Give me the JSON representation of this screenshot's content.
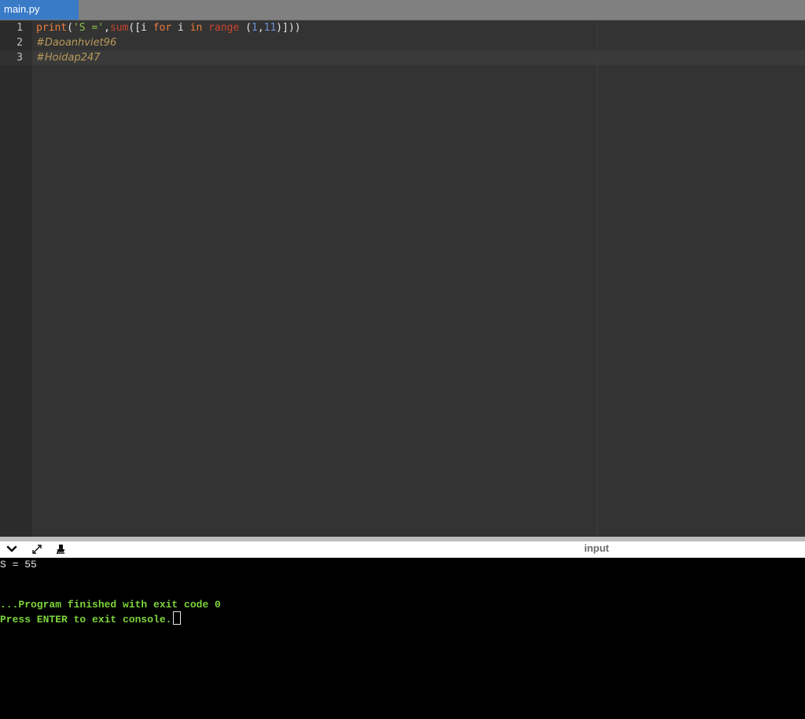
{
  "tab": {
    "label": "main.py"
  },
  "editor": {
    "lines": [
      {
        "number": "1",
        "tokens": {
          "t0": "print",
          "t1": "(",
          "t2": "'S ='",
          "t3": ",",
          "t4": "sum",
          "t5": "([",
          "t6": "i",
          "t7": " ",
          "t8": "for",
          "t9": " ",
          "t10": "i",
          "t11": " ",
          "t12": "in",
          "t13": " ",
          "t14": "range",
          "t15": " (",
          "t16": "1",
          "t17": ",",
          "t18": "11",
          "t19": ")]))"
        }
      },
      {
        "number": "2",
        "text": "#Daoanhviet96"
      },
      {
        "number": "3",
        "text": "#Hoidap247"
      }
    ]
  },
  "console_toolbar": {
    "collapse_icon": "chevron-down-icon",
    "expand_icon": "expand-icon",
    "clear_icon": "clear-icon",
    "input_label": "input"
  },
  "console": {
    "output": "S = 55",
    "finished": "...Program finished with exit code 0",
    "press_enter": "Press ENTER to exit console."
  },
  "colors": {
    "tab_active": "#3a7bc8",
    "editor_bg": "#333333",
    "console_bg": "#000000",
    "console_green": "#7cd43a"
  }
}
